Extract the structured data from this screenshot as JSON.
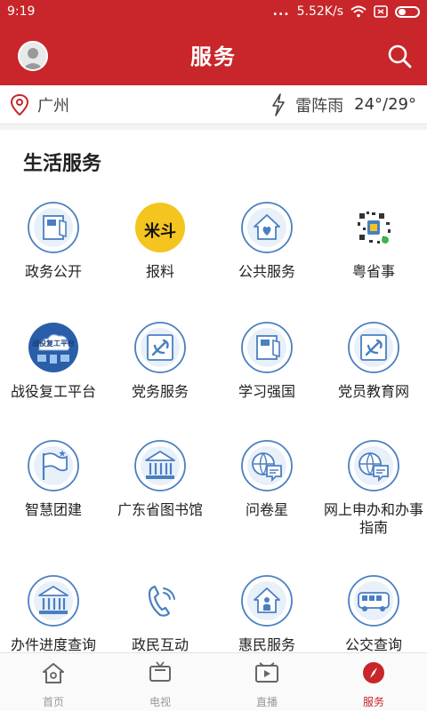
{
  "status_bar": {
    "time": "9:19",
    "network_speed": "5.52K/s",
    "dots": "..."
  },
  "header": {
    "title": "服务"
  },
  "weather": {
    "city": "广州",
    "condition": "雷阵雨",
    "temperature": "24°/29°"
  },
  "section": {
    "title": "生活服务"
  },
  "services": [
    {
      "label": "政务公开",
      "icon": "document-flag-icon"
    },
    {
      "label": "报料",
      "icon": "baoliao-logo-icon",
      "logo_text": "米斗"
    },
    {
      "label": "公共服务",
      "icon": "house-heart-icon"
    },
    {
      "label": "粤省事",
      "icon": "qr-code-icon"
    },
    {
      "label": "战役复工平台",
      "icon": "cloud-devices-icon",
      "logo_text": "战役复工平台"
    },
    {
      "label": "党务服务",
      "icon": "party-emblem-icon"
    },
    {
      "label": "学习强国",
      "icon": "document-flag-icon"
    },
    {
      "label": "党员教育网",
      "icon": "party-emblem-icon"
    },
    {
      "label": "智慧团建",
      "icon": "flag-icon"
    },
    {
      "label": "广东省图书馆",
      "icon": "library-icon"
    },
    {
      "label": "问卷星",
      "icon": "globe-chat-icon"
    },
    {
      "label": "网上申办和办事\n指南",
      "icon": "globe-chat-icon"
    },
    {
      "label": "办件进度查询",
      "icon": "library-icon"
    },
    {
      "label": "政民互动",
      "icon": "phone-icon"
    },
    {
      "label": "惠民服务",
      "icon": "house-person-icon"
    },
    {
      "label": "公交查询",
      "icon": "bus-icon"
    }
  ],
  "bottom_nav": [
    {
      "label": "首页",
      "icon": "home-icon",
      "active": false
    },
    {
      "label": "电视",
      "icon": "tv-icon",
      "active": false
    },
    {
      "label": "直播",
      "icon": "video-icon",
      "active": false
    },
    {
      "label": "服务",
      "icon": "compass-icon",
      "active": true
    }
  ],
  "colors": {
    "brand": "#c8262a",
    "icon_blue": "#4a7fc1",
    "icon_bg": "#ffffff",
    "yellow": "#f4c51f"
  }
}
